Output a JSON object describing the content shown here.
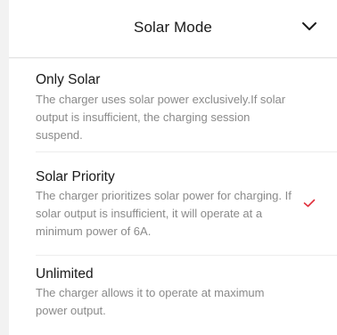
{
  "header": {
    "title": "Solar Mode",
    "collapse_icon": "chevron-down-icon"
  },
  "options": [
    {
      "title": "Only Solar",
      "description": "The charger uses solar power exclusively.If solar output is insufficient, the charging session suspend.",
      "selected": false
    },
    {
      "title": "Solar Priority",
      "description": "The charger prioritizes solar power for charging. If solar output is insufficient, it will operate at a minimum power of 6A.",
      "selected": true
    },
    {
      "title": "Unlimited",
      "description": "The charger allows it to operate at maximum power output.",
      "selected": false
    }
  ],
  "colors": {
    "accent_check": "#e0303c",
    "title_text": "#1a1a1a",
    "desc_text": "#8a8a8a",
    "background": "#f2f2f2"
  }
}
